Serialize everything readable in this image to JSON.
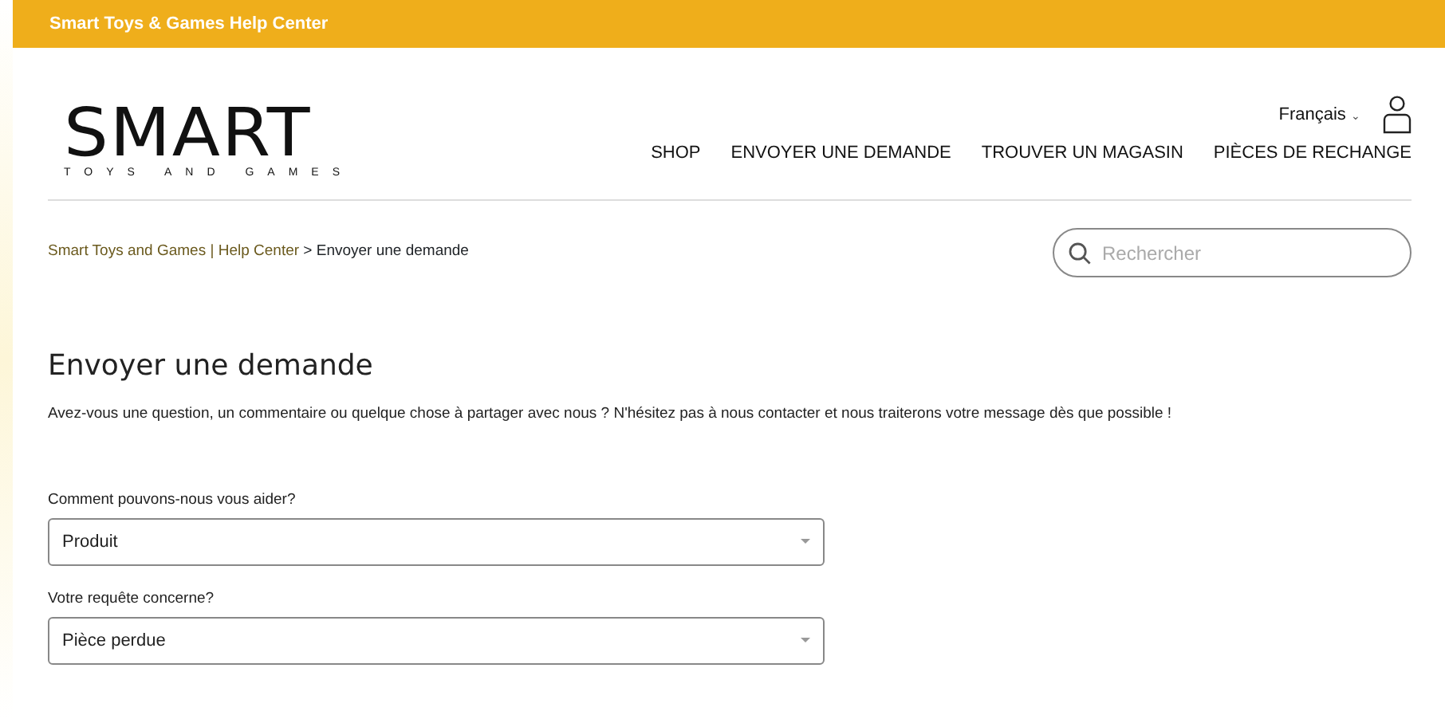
{
  "top_bar": {
    "title": "Smart Toys & Games Help Center"
  },
  "logo": {
    "name": "SMART",
    "tagline": "TOYS AND GAMES"
  },
  "language": {
    "label": "Français",
    "caret": "⌄"
  },
  "nav": [
    "SHOP",
    "ENVOYER UNE DEMANDE",
    "TROUVER UN MAGASIN",
    "PIÈCES DE RECHANGE"
  ],
  "breadcrumb": {
    "link": "Smart Toys and Games | Help Center",
    "separator": ">",
    "current": "Envoyer une demande"
  },
  "search": {
    "placeholder": "Rechercher"
  },
  "heading": "Envoyer une demande",
  "intro": "Avez-vous une question, un commentaire ou quelque chose à partager avec nous ? N'hésitez pas à nous contacter et nous traiterons votre message dès que possible !",
  "fields": [
    {
      "label": "Comment pouvons-nous vous aider?",
      "value": "Produit"
    },
    {
      "label": "Votre requête concerne?",
      "value": "Pièce perdue"
    }
  ]
}
